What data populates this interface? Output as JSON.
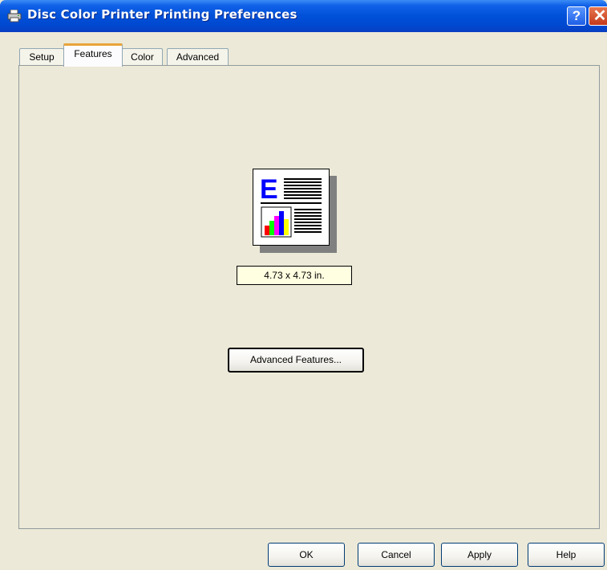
{
  "window": {
    "title": "Disc Color Printer Printing Preferences",
    "title_icon": "printer-icon",
    "help_glyph": "?",
    "close_glyph": "✕"
  },
  "tabs": [
    {
      "label": "Setup",
      "active": false
    },
    {
      "label": "Features",
      "active": true
    },
    {
      "label": "Color",
      "active": false
    },
    {
      "label": "Advanced",
      "active": false
    }
  ],
  "features": {
    "preview_icon": "document-preview-icon",
    "preview_letter": "E",
    "size_label": "4.73 x 4.73 in.",
    "advanced_features_label": "Advanced Features..."
  },
  "buttons": {
    "ok": "OK",
    "cancel": "Cancel",
    "apply": "Apply",
    "help": "Help"
  },
  "colors": {
    "title_bar": "#0050d8",
    "dialog_bg": "#ece9d8",
    "tooltip_bg": "#ffffe1",
    "active_tab_accent": "#e9a43a",
    "preview_letter": "#0000ff"
  }
}
